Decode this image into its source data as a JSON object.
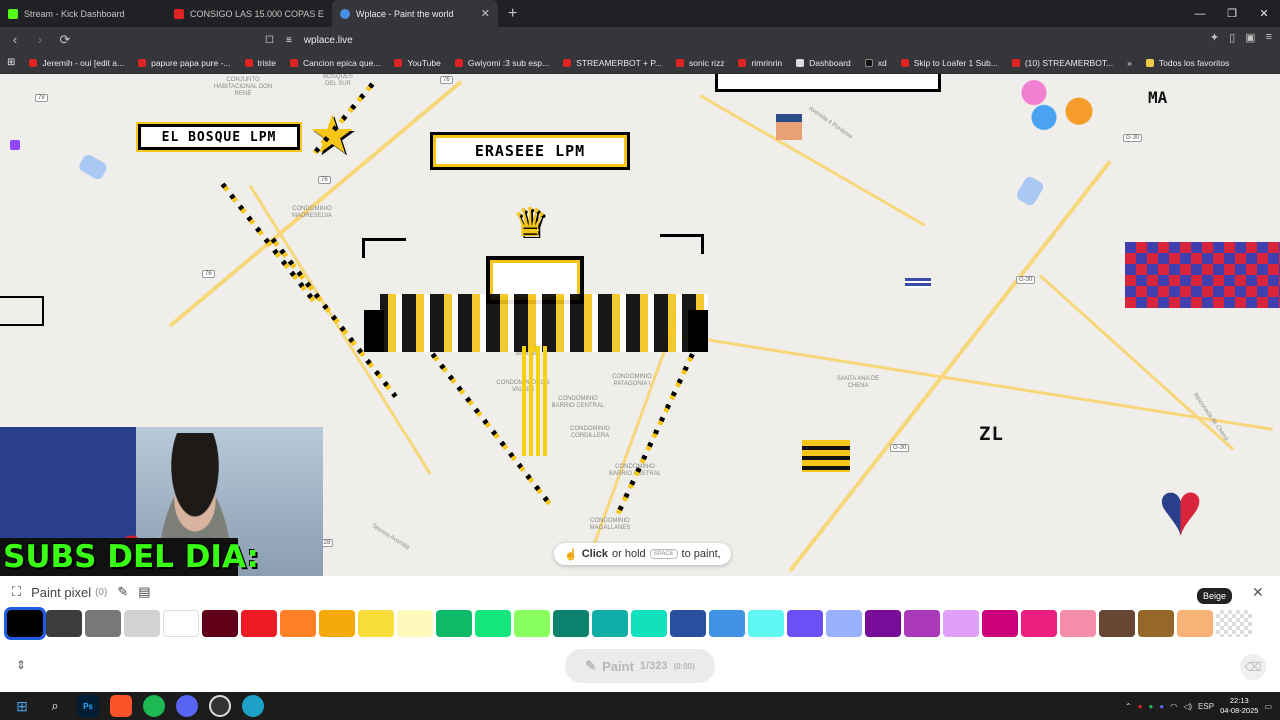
{
  "browser": {
    "tabs": [
      {
        "title": "Stream - Kick Dashboard",
        "color": "#53fc18",
        "active": false
      },
      {
        "title": "CONSIGO LAS 15.000 COPAS EN CLA",
        "color": "#e02424",
        "active": false
      },
      {
        "title": "Wplace - Paint the world",
        "color": "#4a90e2",
        "active": true
      }
    ],
    "url": "wplace.live",
    "bookmarks": [
      {
        "label": "Jeremih - oui [edit a...",
        "folder": false
      },
      {
        "label": "papure papa pure -...",
        "folder": false
      },
      {
        "label": "triste",
        "folder": false
      },
      {
        "label": "Cancion epica que...",
        "folder": false
      },
      {
        "label": "YouTube",
        "folder": false
      },
      {
        "label": "Gwiyomi :3 sub esp...",
        "folder": false
      },
      {
        "label": "STREAMERBOT + P...",
        "folder": false
      },
      {
        "label": "sonic rizz",
        "folder": false
      },
      {
        "label": "rimrinrin",
        "folder": false
      },
      {
        "label": "Dashboard",
        "folder": false
      },
      {
        "label": "xd",
        "folder": false
      },
      {
        "label": "Skip to Loafer 1 Sub...",
        "folder": false
      },
      {
        "label": "(10) STREAMERBOT...",
        "folder": false
      },
      {
        "label": "Todos los favoritos",
        "folder": true
      }
    ]
  },
  "map": {
    "labels": [
      {
        "text": "CONJUNTO HABITACIONAL DON RENÉ"
      },
      {
        "text": "BOSQUES DEL SUR"
      },
      {
        "text": "CONDOMINIO MADRESELVA"
      },
      {
        "text": "CONDOMINIO BARRIO..."
      },
      {
        "text": "CONDOMINIO LOS VALLES"
      },
      {
        "text": "CONDOMINIO PATAGONIA I"
      },
      {
        "text": "CONDOMINIO BARRIO CENTRAL"
      },
      {
        "text": "CONDOMINIO CORDILLERA"
      },
      {
        "text": "CONDOMINIO BARRIO AUSTRAL"
      },
      {
        "text": "CONDOMINIO MAGALLANES"
      },
      {
        "text": "SANTA ANA DE CHENA"
      },
      {
        "text": "Avenida 4 Poniente"
      },
      {
        "text": "Rinconada de Chena"
      },
      {
        "text": "Tercera Avenida"
      }
    ],
    "shields": [
      "78",
      "76",
      "76",
      "76",
      "G-30",
      "G-30",
      "G-30",
      "G-28"
    ],
    "pixel_art_text": {
      "bosque": "EL BOSQUE LPM",
      "rasdes": "ERASEEE LPM",
      "zl": "ZL",
      "ma": "MA"
    }
  },
  "stream_overlay": {
    "subs_label": "SUBS DEL DIA:"
  },
  "paint_hint": {
    "click": "Click",
    "or_hold": "or hold",
    "key": "SPACE",
    "to_paint": "to paint,"
  },
  "panel": {
    "title": "Paint pixel",
    "count": "(0)",
    "tooltip": "Beige",
    "paint_button": "Paint",
    "paint_progress": "1/323",
    "paint_sub": "(0:00)",
    "colors": [
      {
        "name": "Black",
        "hex": "#000000"
      },
      {
        "name": "Dark Gray",
        "hex": "#3c3c3c"
      },
      {
        "name": "Gray",
        "hex": "#787878"
      },
      {
        "name": "Light Gray",
        "hex": "#d2d2d2"
      },
      {
        "name": "White",
        "hex": "#ffffff"
      },
      {
        "name": "Deep Red",
        "hex": "#600018"
      },
      {
        "name": "Red",
        "hex": "#ed1c24"
      },
      {
        "name": "Orange",
        "hex": "#ff7f27"
      },
      {
        "name": "Gold",
        "hex": "#f6aa09"
      },
      {
        "name": "Yellow",
        "hex": "#f9dd3b"
      },
      {
        "name": "Light Yellow",
        "hex": "#fffabc"
      },
      {
        "name": "Dark Green",
        "hex": "#0eb968"
      },
      {
        "name": "Green",
        "hex": "#13e67b"
      },
      {
        "name": "Light Green",
        "hex": "#87ff5e"
      },
      {
        "name": "Dark Teal",
        "hex": "#0c816e"
      },
      {
        "name": "Teal",
        "hex": "#10aea6"
      },
      {
        "name": "Light Teal",
        "hex": "#13e1be"
      },
      {
        "name": "Dark Blue",
        "hex": "#28509e"
      },
      {
        "name": "Blue",
        "hex": "#4093e4"
      },
      {
        "name": "Cyan",
        "hex": "#60f7f2"
      },
      {
        "name": "Indigo",
        "hex": "#6b50f6"
      },
      {
        "name": "Light Indigo",
        "hex": "#99b1fb"
      },
      {
        "name": "Dark Purple",
        "hex": "#780c99"
      },
      {
        "name": "Purple",
        "hex": "#aa38b9"
      },
      {
        "name": "Light Purple",
        "hex": "#e09ff9"
      },
      {
        "name": "Dark Pink",
        "hex": "#cb007a"
      },
      {
        "name": "Pink",
        "hex": "#ec1f80"
      },
      {
        "name": "Light Pink",
        "hex": "#f38da9"
      },
      {
        "name": "Dark Brown",
        "hex": "#684634"
      },
      {
        "name": "Brown",
        "hex": "#95682a"
      },
      {
        "name": "Beige",
        "hex": "#f8b277"
      },
      {
        "name": "Transparent",
        "hex": "transparent"
      }
    ],
    "selected_index": 0
  },
  "taskbar": {
    "lang": "ESP",
    "time": "22:13",
    "date": "04-08-2025"
  }
}
